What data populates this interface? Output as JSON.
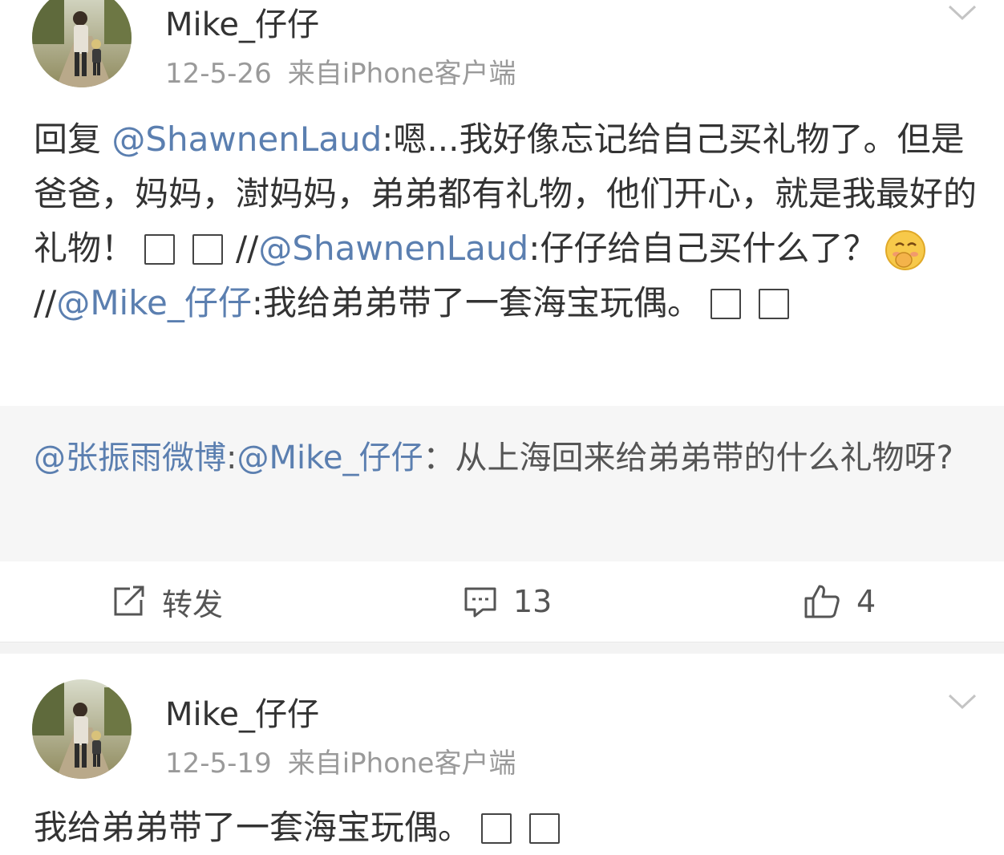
{
  "posts": [
    {
      "username": "Mike_仔仔",
      "date": "12-5-26",
      "source": "来自iPhone客户端",
      "body": {
        "p1": "回复",
        "m1": "@ShawnenLaud",
        "p2": ":嗯...我好像忘记给自己买礼物了。但是爸爸，妈妈，澍妈妈，弟弟都有礼物，他们开心，就是我最好的礼物！",
        "p3": "//",
        "m2": "@ShawnenLaud",
        "p4": ":仔仔给自己买什么了？",
        "p5": "//",
        "m3": "@Mike_仔仔",
        "p6": ":我给弟弟带了一套海宝玩偶。"
      },
      "quote": {
        "m1": "@张振雨微博",
        "p1": ":",
        "m2": "@Mike_仔仔",
        "p2": "：从上海回来给弟弟带的什么礼物呀?"
      },
      "actions": {
        "forward_label": "转发",
        "comment_count": "13",
        "like_count": "4"
      }
    },
    {
      "username": "Mike_仔仔",
      "date": "12-5-19",
      "source": "来自iPhone客户端",
      "body": {
        "p1": "我给弟弟带了一套海宝玩偶。"
      }
    }
  ],
  "icons": {
    "menu": "chevron-down-icon",
    "forward": "forward-icon",
    "comment": "comment-icon",
    "like": "thumbs-up-icon",
    "emoji": "shy-face-emoji",
    "missing_glyph": "missing-glyph-box"
  },
  "colors": {
    "mention": "#5b7fb0",
    "text": "#333333",
    "meta": "#9a9a9a",
    "quote_bg": "#f6f6f6"
  }
}
